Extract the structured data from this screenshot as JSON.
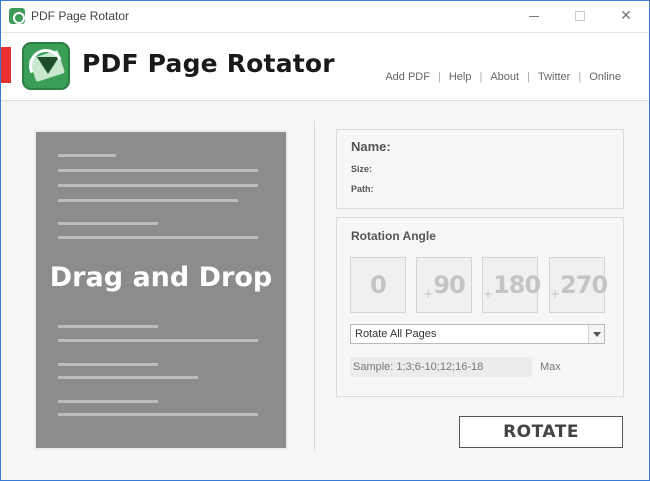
{
  "window": {
    "title": "PDF Page Rotator",
    "controls": {
      "minimize": "",
      "maximize": "",
      "close": "✕"
    }
  },
  "header": {
    "app_title": "PDF Page Rotator",
    "logo_icon": "pdf-rotate-logo-icon",
    "nav": [
      {
        "label": "Add PDF"
      },
      {
        "label": "Help"
      },
      {
        "label": "About"
      },
      {
        "label": "Twitter"
      },
      {
        "label": "Online"
      }
    ],
    "nav_separator": "|"
  },
  "drop_zone": {
    "label": "Drag and Drop"
  },
  "file_info": {
    "name_label": "Name:",
    "size_label": "Size:",
    "path_label": "Path:"
  },
  "rotation": {
    "title": "Rotation Angle",
    "angles": [
      {
        "value": "0",
        "prefix": ""
      },
      {
        "value": "90",
        "prefix": "+"
      },
      {
        "value": "180",
        "prefix": "+"
      },
      {
        "value": "270",
        "prefix": "+"
      }
    ],
    "page_select": {
      "selected": "Rotate All Pages"
    },
    "sample": {
      "placeholder": "Sample: 1;3;6-10;12;16-18",
      "value": ""
    },
    "max_label": "Max"
  },
  "action": {
    "rotate_label": "ROTATE"
  },
  "colors": {
    "accent_red": "#e8312f",
    "logo_green": "#3a9e58",
    "drop_zone_gray": "#8c8c8c"
  }
}
